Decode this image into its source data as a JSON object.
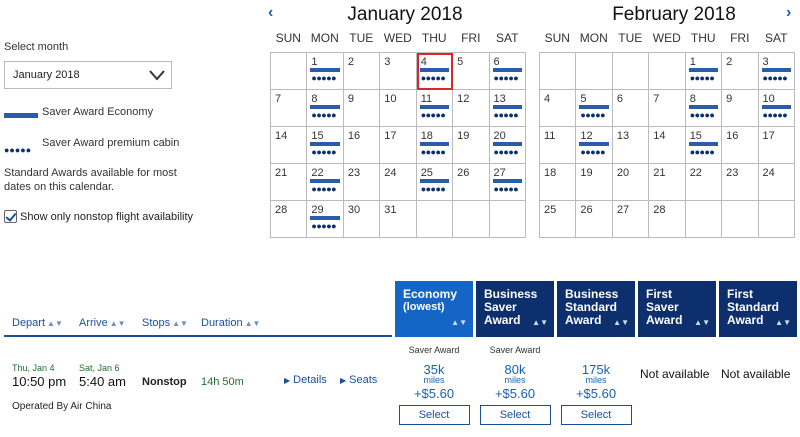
{
  "left_panel": {
    "select_month_label": "Select month",
    "month_value": "January 2018",
    "legend_saver_economy": "Saver Award Economy",
    "legend_saver_premium": "Saver Award premium cabin",
    "standard_note": "Standard Awards available for most dates on this calendar.",
    "nonstop_label": "Show only nonstop flight availability",
    "nonstop_checked": true
  },
  "calendar": {
    "prev_arrow": "‹",
    "next_arrow": "›",
    "dow": [
      "SUN",
      "MON",
      "TUE",
      "WED",
      "THU",
      "FRI",
      "SAT"
    ],
    "months": [
      {
        "title": "January 2018",
        "weeks": [
          [
            {
              "d": ""
            },
            {
              "d": "1",
              "saver": true,
              "prem": true
            },
            {
              "d": "2"
            },
            {
              "d": "3"
            },
            {
              "d": "4",
              "saver": true,
              "prem": true,
              "selected": true
            },
            {
              "d": "5"
            },
            {
              "d": "6",
              "saver": true,
              "prem": true
            }
          ],
          [
            {
              "d": "7"
            },
            {
              "d": "8",
              "saver": true,
              "prem": true
            },
            {
              "d": "9"
            },
            {
              "d": "10"
            },
            {
              "d": "11",
              "saver": true,
              "prem": true
            },
            {
              "d": "12"
            },
            {
              "d": "13",
              "saver": true,
              "prem": true
            }
          ],
          [
            {
              "d": "14"
            },
            {
              "d": "15",
              "saver": true,
              "prem": true
            },
            {
              "d": "16"
            },
            {
              "d": "17"
            },
            {
              "d": "18",
              "saver": true,
              "prem": true
            },
            {
              "d": "19"
            },
            {
              "d": "20",
              "saver": true,
              "prem": true
            }
          ],
          [
            {
              "d": "21"
            },
            {
              "d": "22",
              "saver": true,
              "prem": true
            },
            {
              "d": "23"
            },
            {
              "d": "24"
            },
            {
              "d": "25",
              "saver": true,
              "prem": true
            },
            {
              "d": "26"
            },
            {
              "d": "27",
              "saver": true,
              "prem": true
            }
          ],
          [
            {
              "d": "28"
            },
            {
              "d": "29",
              "saver": true,
              "prem": true
            },
            {
              "d": "30"
            },
            {
              "d": "31"
            },
            {
              "d": ""
            },
            {
              "d": ""
            },
            {
              "d": ""
            }
          ]
        ]
      },
      {
        "title": "February 2018",
        "weeks": [
          [
            {
              "d": ""
            },
            {
              "d": ""
            },
            {
              "d": ""
            },
            {
              "d": ""
            },
            {
              "d": "1",
              "saver": true,
              "prem": true
            },
            {
              "d": "2"
            },
            {
              "d": "3",
              "saver": true,
              "prem": true
            }
          ],
          [
            {
              "d": "4"
            },
            {
              "d": "5",
              "saver": true,
              "prem": true
            },
            {
              "d": "6"
            },
            {
              "d": "7"
            },
            {
              "d": "8",
              "saver": true,
              "prem": true
            },
            {
              "d": "9"
            },
            {
              "d": "10",
              "saver": true,
              "prem": true
            }
          ],
          [
            {
              "d": "11"
            },
            {
              "d": "12",
              "saver": true,
              "prem": true
            },
            {
              "d": "13"
            },
            {
              "d": "14"
            },
            {
              "d": "15",
              "saver": true,
              "prem": true
            },
            {
              "d": "16"
            },
            {
              "d": "17"
            }
          ],
          [
            {
              "d": "18"
            },
            {
              "d": "19"
            },
            {
              "d": "20"
            },
            {
              "d": "21"
            },
            {
              "d": "22"
            },
            {
              "d": "23"
            },
            {
              "d": "24"
            }
          ],
          [
            {
              "d": "25"
            },
            {
              "d": "26"
            },
            {
              "d": "27"
            },
            {
              "d": "28"
            },
            {
              "d": ""
            },
            {
              "d": ""
            },
            {
              "d": ""
            }
          ]
        ]
      }
    ]
  },
  "results": {
    "sort_columns": [
      "Depart",
      "Arrive",
      "Stops",
      "Duration"
    ],
    "fare_columns": [
      {
        "line1": "Economy",
        "line2": "(lowest)",
        "active": true
      },
      {
        "line1": "Business",
        "line2": "Saver",
        "line3": "Award"
      },
      {
        "line1": "Business",
        "line2": "Standard",
        "line3": "Award"
      },
      {
        "line1": "First Saver",
        "line2": "Award"
      },
      {
        "line1": "First",
        "line2": "Standard",
        "line3": "Award"
      }
    ],
    "flight": {
      "depart_date": "Thu, Jan 4",
      "depart_time": "10:50 pm",
      "arrive_date": "Sat, Jan 6",
      "arrive_time": "5:40 am",
      "stops": "Nonstop",
      "duration": "14h 50m",
      "details_link": "Details",
      "seats_link": "Seats",
      "operated_by": "Operated By Air China",
      "fares": [
        {
          "label": "Saver Award",
          "miles": "35k",
          "miles_unit": "miles",
          "tax": "+$5.60",
          "button": "Select"
        },
        {
          "label": "Saver Award",
          "miles": "80k",
          "miles_unit": "miles",
          "tax": "+$5.60",
          "button": "Select"
        },
        {
          "label": "",
          "miles": "175k",
          "miles_unit": "miles",
          "tax": "+$5.60",
          "button": "Select"
        }
      ],
      "not_available": [
        "Not available",
        "Not available"
      ]
    }
  },
  "colors": {
    "saver_bar": "#2a5caa",
    "premium_dots": "#0d2f6e",
    "selected_outline": "#d9262c",
    "header_navy": "#0d2f6e",
    "header_active": "#1565c7",
    "link_blue": "#1a4f9c"
  }
}
